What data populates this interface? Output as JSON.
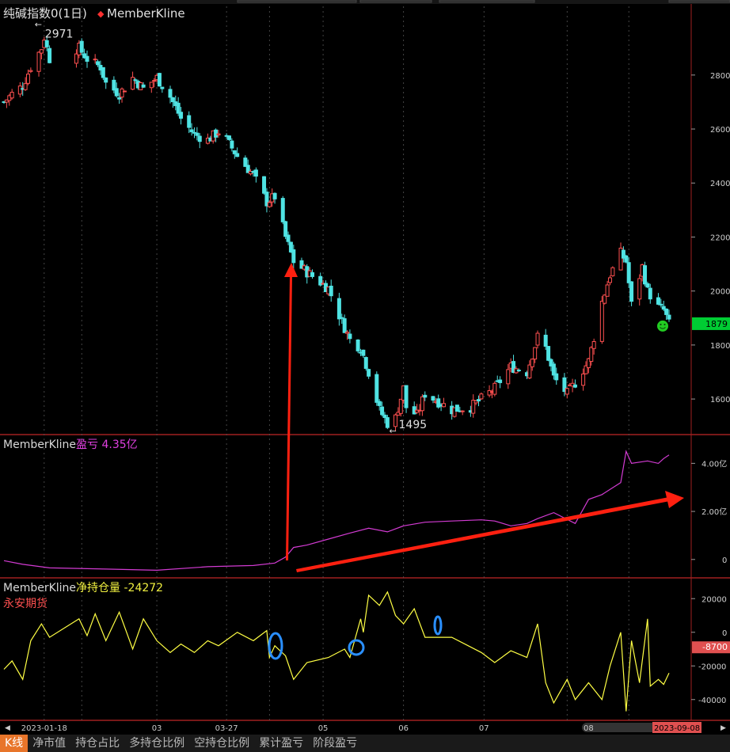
{
  "colors": {
    "up": "#ff5050",
    "down": "#4fe3e3",
    "grid": "#8a1a1a",
    "panel_border": "#a02020",
    "pnl_line": "#d33bd3",
    "net_line": "#ffff44",
    "annotation_arrow": "#ff2010",
    "annotation_circle": "#2a8fff",
    "last_price_tag": "#00cc33",
    "net_tag": "#e05050",
    "date_tag": "#e05050",
    "tab_active": "#e8752a"
  },
  "top_panel": {
    "title": "纯碱指数0(1日)",
    "legend_marker": "◆",
    "legend_name": "MemberKline",
    "max_label": "2971",
    "min_label": "1495",
    "last_price": "1879",
    "y_ticks": [
      "2800",
      "2600",
      "2400",
      "2200",
      "2000",
      "1800",
      "1600"
    ]
  },
  "pnl_panel": {
    "name": "MemberKline",
    "label": "盈亏 4.35亿",
    "y_ticks": [
      "4.00亿",
      "2.00亿",
      "0"
    ]
  },
  "net_panel": {
    "name": "MemberKline",
    "label": "净持仓量 -24272",
    "broker": "永安期货",
    "y_ticks": [
      "20000",
      "0",
      "-20000",
      "-40000"
    ],
    "current_tag": "-8700"
  },
  "x_axis": {
    "labels": [
      "2023-01-18",
      "03",
      "03-27",
      "05",
      "06",
      "07",
      "08"
    ],
    "end_date": "2023-09-08"
  },
  "tabs": [
    "K线",
    "净市值",
    "持仓占比",
    "多持仓比例",
    "空持仓比例",
    "累计盈亏",
    "阶段盈亏"
  ],
  "chart_data": [
    {
      "type": "candlestick",
      "title": "纯碱指数0(1日)",
      "series_name": "MemberKline",
      "x_range": [
        "2023-01-03",
        "2023-09-08"
      ],
      "ylim": [
        1480,
        2990
      ],
      "close_path": [
        {
          "date": "2023-01-03",
          "close": 2700
        },
        {
          "date": "2023-01-06",
          "close": 2730
        },
        {
          "date": "2023-01-10",
          "close": 2760
        },
        {
          "date": "2023-01-13",
          "close": 2830
        },
        {
          "date": "2023-01-17",
          "close": 2900
        },
        {
          "date": "2023-01-18",
          "close": 2940
        },
        {
          "date": "2023-01-20",
          "close": 2860
        },
        {
          "date": "2023-01-31",
          "close": 2900
        },
        {
          "date": "2023-02-03",
          "close": 2860
        },
        {
          "date": "2023-02-08",
          "close": 2830
        },
        {
          "date": "2023-02-10",
          "close": 2770
        },
        {
          "date": "2023-02-15",
          "close": 2730
        },
        {
          "date": "2023-02-20",
          "close": 2790
        },
        {
          "date": "2023-02-24",
          "close": 2750
        },
        {
          "date": "2023-03-01",
          "close": 2790
        },
        {
          "date": "2023-03-06",
          "close": 2720
        },
        {
          "date": "2023-03-10",
          "close": 2640
        },
        {
          "date": "2023-03-15",
          "close": 2580
        },
        {
          "date": "2023-03-20",
          "close": 2560
        },
        {
          "date": "2023-03-24",
          "close": 2590
        },
        {
          "date": "2023-03-27",
          "close": 2560
        },
        {
          "date": "2023-03-31",
          "close": 2500
        },
        {
          "date": "2023-04-06",
          "close": 2430
        },
        {
          "date": "2023-04-11",
          "close": 2330
        },
        {
          "date": "2023-04-14",
          "close": 2350
        },
        {
          "date": "2023-04-18",
          "close": 2200
        },
        {
          "date": "2023-04-21",
          "close": 2110
        },
        {
          "date": "2023-04-26",
          "close": 2070
        },
        {
          "date": "2023-05-04",
          "close": 2010
        },
        {
          "date": "2023-05-08",
          "close": 1910
        },
        {
          "date": "2023-05-12",
          "close": 1820
        },
        {
          "date": "2023-05-16",
          "close": 1790
        },
        {
          "date": "2023-05-19",
          "close": 1700
        },
        {
          "date": "2023-05-23",
          "close": 1560
        },
        {
          "date": "2023-05-26",
          "close": 1510
        },
        {
          "date": "2023-05-29",
          "close": 1530
        },
        {
          "date": "2023-06-01",
          "close": 1640
        },
        {
          "date": "2023-06-02",
          "close": 1570
        },
        {
          "date": "2023-06-06",
          "close": 1540
        },
        {
          "date": "2023-06-09",
          "close": 1620
        },
        {
          "date": "2023-06-14",
          "close": 1590
        },
        {
          "date": "2023-06-19",
          "close": 1560
        },
        {
          "date": "2023-06-26",
          "close": 1570
        },
        {
          "date": "2023-06-30",
          "close": 1600
        },
        {
          "date": "2023-07-05",
          "close": 1640
        },
        {
          "date": "2023-07-11",
          "close": 1720
        },
        {
          "date": "2023-07-17",
          "close": 1700
        },
        {
          "date": "2023-07-21",
          "close": 1830
        },
        {
          "date": "2023-07-24",
          "close": 1790
        },
        {
          "date": "2023-07-27",
          "close": 1680
        },
        {
          "date": "2023-08-01",
          "close": 1620
        },
        {
          "date": "2023-08-04",
          "close": 1660
        },
        {
          "date": "2023-08-09",
          "close": 1740
        },
        {
          "date": "2023-08-14",
          "close": 1960
        },
        {
          "date": "2023-08-17",
          "close": 2060
        },
        {
          "date": "2023-08-21",
          "close": 2140
        },
        {
          "date": "2023-08-23",
          "close": 2110
        },
        {
          "date": "2023-08-25",
          "close": 1950
        },
        {
          "date": "2023-08-29",
          "close": 2090
        },
        {
          "date": "2023-08-31",
          "close": 2000
        },
        {
          "date": "2023-09-04",
          "close": 1940
        },
        {
          "date": "2023-09-06",
          "close": 1930
        },
        {
          "date": "2023-09-08",
          "close": 1879
        }
      ],
      "labels": [
        {
          "text": "2971",
          "date": "2023-01-18",
          "value": 2971
        },
        {
          "text": "1495",
          "date": "2023-05-29",
          "value": 1495
        }
      ],
      "last_value": 1879
    },
    {
      "type": "line",
      "title": "盈亏 4.35亿",
      "unit": "亿",
      "ylim": [
        -0.6,
        5.0
      ],
      "points": [
        {
          "date": "2023-01-03",
          "value": -0.05
        },
        {
          "date": "2023-01-10",
          "value": -0.2
        },
        {
          "date": "2023-01-20",
          "value": -0.35
        },
        {
          "date": "2023-02-10",
          "value": -0.4
        },
        {
          "date": "2023-03-01",
          "value": -0.45
        },
        {
          "date": "2023-03-20",
          "value": -0.3
        },
        {
          "date": "2023-04-06",
          "value": -0.25
        },
        {
          "date": "2023-04-14",
          "value": -0.15
        },
        {
          "date": "2023-04-18",
          "value": 0.1
        },
        {
          "date": "2023-04-21",
          "value": 0.5
        },
        {
          "date": "2023-04-26",
          "value": 0.6
        },
        {
          "date": "2023-05-04",
          "value": 0.85
        },
        {
          "date": "2023-05-12",
          "value": 1.1
        },
        {
          "date": "2023-05-19",
          "value": 1.3
        },
        {
          "date": "2023-05-26",
          "value": 1.15
        },
        {
          "date": "2023-06-01",
          "value": 1.4
        },
        {
          "date": "2023-06-09",
          "value": 1.55
        },
        {
          "date": "2023-06-19",
          "value": 1.6
        },
        {
          "date": "2023-06-30",
          "value": 1.65
        },
        {
          "date": "2023-07-05",
          "value": 1.6
        },
        {
          "date": "2023-07-11",
          "value": 1.4
        },
        {
          "date": "2023-07-17",
          "value": 1.5
        },
        {
          "date": "2023-07-21",
          "value": 1.7
        },
        {
          "date": "2023-07-27",
          "value": 1.95
        },
        {
          "date": "2023-08-04",
          "value": 1.5
        },
        {
          "date": "2023-08-09",
          "value": 2.5
        },
        {
          "date": "2023-08-14",
          "value": 2.7
        },
        {
          "date": "2023-08-21",
          "value": 3.2
        },
        {
          "date": "2023-08-23",
          "value": 4.5
        },
        {
          "date": "2023-08-25",
          "value": 4.0
        },
        {
          "date": "2023-08-31",
          "value": 4.1
        },
        {
          "date": "2023-09-04",
          "value": 4.0
        },
        {
          "date": "2023-09-06",
          "value": 4.2
        },
        {
          "date": "2023-09-08",
          "value": 4.35
        }
      ]
    },
    {
      "type": "line",
      "title": "净持仓量 -24272",
      "ylim": [
        -50000,
        30000
      ],
      "points": [
        {
          "date": "2023-01-03",
          "value": -22000
        },
        {
          "date": "2023-01-06",
          "value": -17000
        },
        {
          "date": "2023-01-10",
          "value": -28000
        },
        {
          "date": "2023-01-13",
          "value": -5000
        },
        {
          "date": "2023-01-17",
          "value": 5000
        },
        {
          "date": "2023-01-20",
          "value": -3000
        },
        {
          "date": "2023-01-31",
          "value": 8000
        },
        {
          "date": "2023-02-03",
          "value": -2000
        },
        {
          "date": "2023-02-06",
          "value": 11000
        },
        {
          "date": "2023-02-10",
          "value": -5000
        },
        {
          "date": "2023-02-15",
          "value": 12000
        },
        {
          "date": "2023-02-20",
          "value": -10000
        },
        {
          "date": "2023-02-24",
          "value": 8000
        },
        {
          "date": "2023-03-01",
          "value": -5000
        },
        {
          "date": "2023-03-06",
          "value": -12000
        },
        {
          "date": "2023-03-10",
          "value": -7000
        },
        {
          "date": "2023-03-15",
          "value": -12000
        },
        {
          "date": "2023-03-20",
          "value": -5000
        },
        {
          "date": "2023-03-24",
          "value": -8000
        },
        {
          "date": "2023-03-31",
          "value": 0
        },
        {
          "date": "2023-04-06",
          "value": -5000
        },
        {
          "date": "2023-04-11",
          "value": 1000
        },
        {
          "date": "2023-04-12",
          "value": -15000
        },
        {
          "date": "2023-04-14",
          "value": -8000
        },
        {
          "date": "2023-04-18",
          "value": -14000
        },
        {
          "date": "2023-04-21",
          "value": -28000
        },
        {
          "date": "2023-04-26",
          "value": -18000
        },
        {
          "date": "2023-05-04",
          "value": -15000
        },
        {
          "date": "2023-05-10",
          "value": -10000
        },
        {
          "date": "2023-05-12",
          "value": -15000
        },
        {
          "date": "2023-05-16",
          "value": 8000
        },
        {
          "date": "2023-05-17",
          "value": 0
        },
        {
          "date": "2023-05-19",
          "value": 22000
        },
        {
          "date": "2023-05-23",
          "value": 16000
        },
        {
          "date": "2023-05-26",
          "value": 24000
        },
        {
          "date": "2023-05-29",
          "value": 10000
        },
        {
          "date": "2023-06-01",
          "value": 5000
        },
        {
          "date": "2023-06-05",
          "value": 14000
        },
        {
          "date": "2023-06-09",
          "value": -3000
        },
        {
          "date": "2023-06-19",
          "value": -3000
        },
        {
          "date": "2023-06-30",
          "value": -12000
        },
        {
          "date": "2023-07-05",
          "value": -18000
        },
        {
          "date": "2023-07-11",
          "value": -11000
        },
        {
          "date": "2023-07-17",
          "value": -15000
        },
        {
          "date": "2023-07-21",
          "value": 5000
        },
        {
          "date": "2023-07-24",
          "value": -30000
        },
        {
          "date": "2023-07-27",
          "value": -42000
        },
        {
          "date": "2023-08-01",
          "value": -28000
        },
        {
          "date": "2023-08-04",
          "value": -40000
        },
        {
          "date": "2023-08-09",
          "value": -30000
        },
        {
          "date": "2023-08-14",
          "value": -40000
        },
        {
          "date": "2023-08-17",
          "value": -20000
        },
        {
          "date": "2023-08-21",
          "value": 0
        },
        {
          "date": "2023-08-23",
          "value": -47000
        },
        {
          "date": "2023-08-25",
          "value": -5000
        },
        {
          "date": "2023-08-28",
          "value": -30000
        },
        {
          "date": "2023-08-31",
          "value": 8000
        },
        {
          "date": "2023-09-01",
          "value": -32000
        },
        {
          "date": "2023-09-04",
          "value": -28000
        },
        {
          "date": "2023-09-06",
          "value": -31000
        },
        {
          "date": "2023-09-08",
          "value": -24272
        }
      ]
    }
  ]
}
